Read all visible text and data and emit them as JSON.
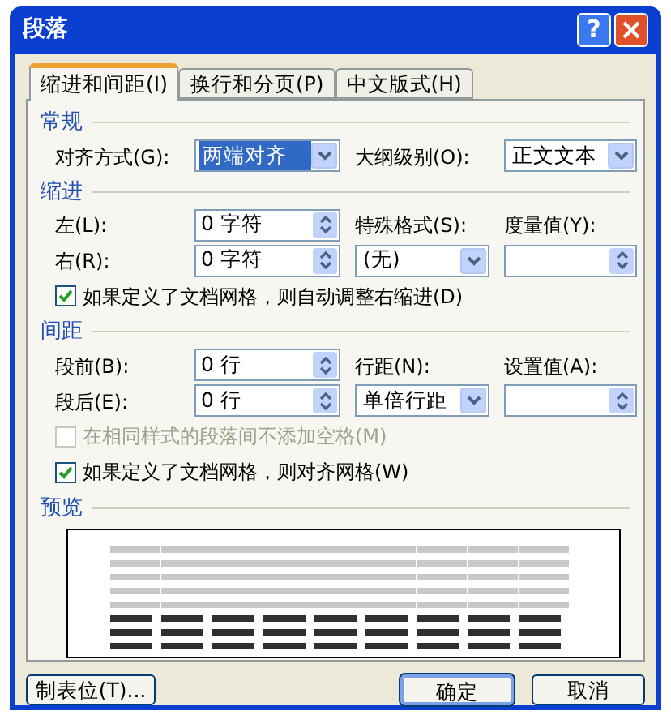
{
  "window": {
    "title": "段落",
    "help_button": "?"
  },
  "tabs": [
    {
      "label": "缩进和间距(I)",
      "selected": true
    },
    {
      "label": "换行和分页(P)",
      "selected": false
    },
    {
      "label": "中文版式(H)",
      "selected": false
    }
  ],
  "sections": [
    {
      "title": "常规",
      "rows": [
        [
          {
            "kind": "label",
            "text": "对齐方式(G):"
          },
          {
            "kind": "dropdown",
            "value": "两端对齐",
            "focused": true
          },
          {
            "kind": "label",
            "text": "大纲级别(O):"
          },
          {
            "kind": "dropdown",
            "value": "正文文本",
            "focused": false
          }
        ]
      ]
    },
    {
      "title": "缩进",
      "rows": [
        [
          {
            "kind": "label",
            "text": "左(L):"
          },
          {
            "kind": "spin",
            "value": "0 字符"
          },
          {
            "kind": "label",
            "text": "特殊格式(S):"
          },
          {
            "kind": "label",
            "text": "度量值(Y):"
          }
        ],
        [
          {
            "kind": "label",
            "text": "右(R):"
          },
          {
            "kind": "spin",
            "value": "0 字符"
          },
          {
            "kind": "dropdown",
            "value": "(无)",
            "focused": false
          },
          {
            "kind": "spin"
          }
        ],
        [
          {
            "kind": "checkbox",
            "text": "如果定义了文档网格，则自动调整右缩进(D)",
            "checked": true,
            "disabled": false
          }
        ]
      ]
    },
    {
      "title": "间距",
      "rows": [
        [
          {
            "kind": "label",
            "text": "段前(B):"
          },
          {
            "kind": "spin",
            "value": "0 行"
          },
          {
            "kind": "label",
            "text": "行距(N):"
          },
          {
            "kind": "label",
            "text": "设置值(A):"
          }
        ],
        [
          {
            "kind": "label",
            "text": "段后(E):"
          },
          {
            "kind": "spin",
            "value": "0 行"
          },
          {
            "kind": "dropdown",
            "value": "单倍行距",
            "focused": false
          },
          {
            "kind": "spin"
          }
        ],
        [
          {
            "kind": "checkbox",
            "text": "在相同样式的段落间不添加空格(M)",
            "checked": false,
            "disabled": true
          }
        ],
        [
          {
            "kind": "checkbox",
            "text": "如果定义了文档网格，则对齐网格(W)",
            "checked": true,
            "disabled": false
          }
        ]
      ]
    },
    {
      "title": "预览",
      "rows": [
        [
          {
            "kind": "preview"
          }
        ]
      ]
    }
  ],
  "buttons": [
    {
      "label": "制表位(T)...",
      "default": false
    },
    {
      "label": "确定",
      "default": true
    },
    {
      "label": "取消",
      "default": false
    }
  ]
}
